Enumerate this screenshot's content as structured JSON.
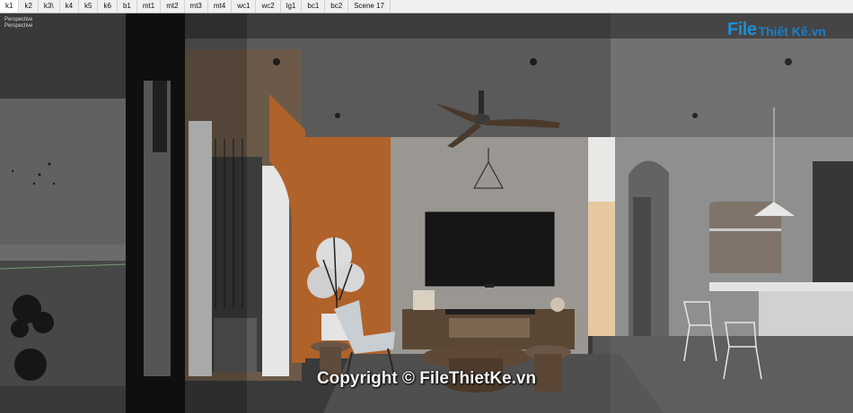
{
  "scene_tabs": [
    "k1",
    "k2",
    "k3\\",
    "k4",
    "k5",
    "k6",
    "b1",
    "mt1",
    "mt2",
    "mt3",
    "mt4",
    "wc1",
    "wc2",
    "lg1",
    "bc1",
    "bc2",
    "Scene 17"
  ],
  "active_tab": "k1",
  "viewport": {
    "camera_label_1": "Perspective",
    "camera_label_2": "Perspective"
  },
  "logo": {
    "part1": "File",
    "part2": "Thiết Kế.vn"
  },
  "watermark": "Copyright © FileThietKe.vn",
  "colors": {
    "accent_wall": "#b0622b",
    "concrete_wall": "#9a9792",
    "logo_blue": "#1a8fd8"
  }
}
